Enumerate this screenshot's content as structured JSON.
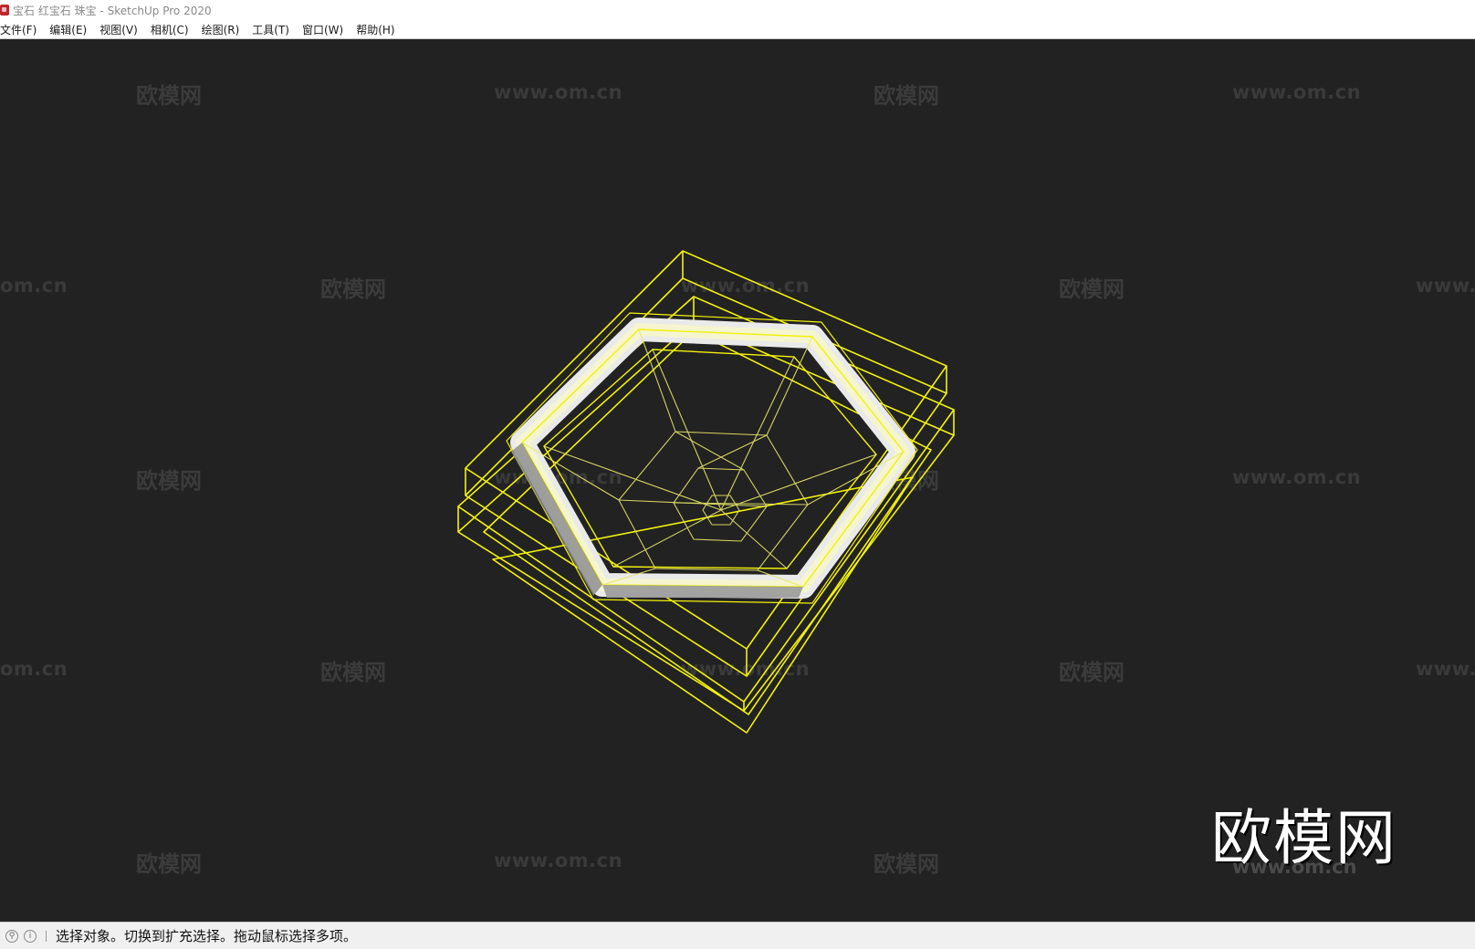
{
  "window": {
    "title": "宝石 红宝石 珠宝 - SketchUp Pro 2020"
  },
  "menu": {
    "items": [
      {
        "label": "文件(F)"
      },
      {
        "label": "编辑(E)"
      },
      {
        "label": "视图(V)"
      },
      {
        "label": "相机(C)"
      },
      {
        "label": "绘图(R)"
      },
      {
        "label": "工具(T)"
      },
      {
        "label": "窗口(W)"
      },
      {
        "label": "帮助(H)"
      }
    ]
  },
  "viewport": {
    "background": "#222222",
    "selection_color": "#f2f20a",
    "watermark_cn": "欧模网",
    "watermark_url": "www.om.cn",
    "watermark_partial_url": "om.cn",
    "watermark_partial_www": "www.",
    "logo_cn": "欧模网",
    "logo_url": "www.om.cn"
  },
  "statusbar": {
    "message": "选择对象。切换到扩充选择。拖动鼠标选择多项。"
  }
}
